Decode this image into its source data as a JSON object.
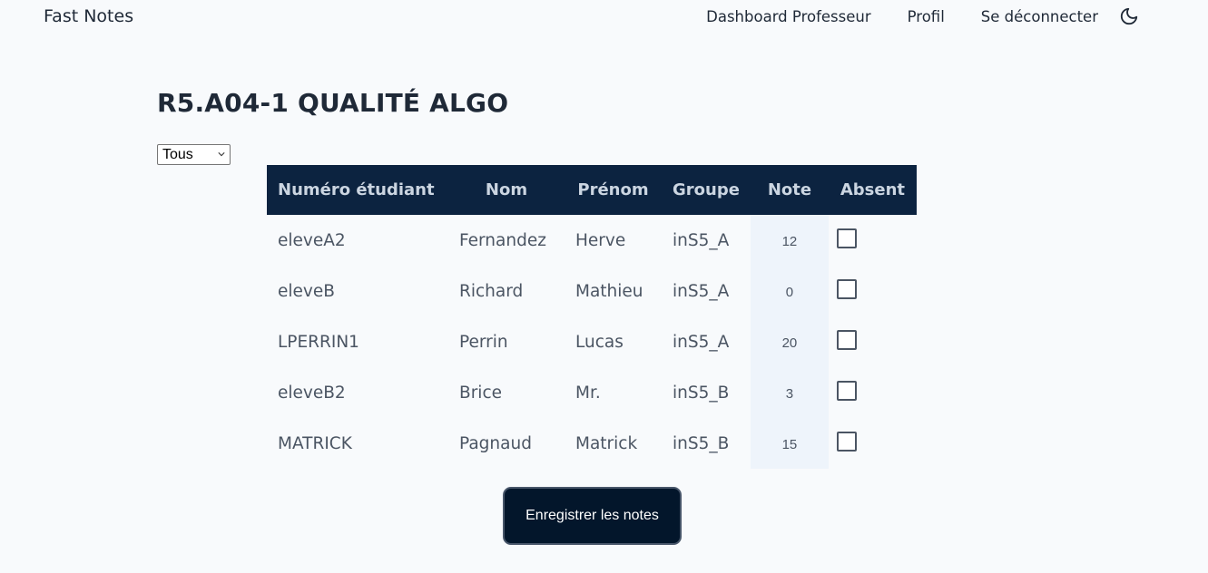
{
  "navbar": {
    "brand": "Fast Notes",
    "links": [
      {
        "label": "Dashboard Professeur"
      },
      {
        "label": "Profil"
      },
      {
        "label": "Se déconnecter"
      }
    ],
    "theme_icon": "moon-icon"
  },
  "page": {
    "title": "R5.A04-1 QUALITÉ ALGO"
  },
  "filter": {
    "selected": "Tous"
  },
  "table": {
    "headers": [
      "Numéro étudiant",
      "Nom",
      "Prénom",
      "Groupe",
      "Note",
      "Absent"
    ],
    "rows": [
      {
        "numero": "eleveA2",
        "nom": "Fernandez",
        "prenom": "Herve",
        "groupe": "inS5_A",
        "note": "12",
        "absent": false
      },
      {
        "numero": "eleveB",
        "nom": "Richard",
        "prenom": "Mathieu",
        "groupe": "inS5_A",
        "note": "0",
        "absent": false
      },
      {
        "numero": "LPERRIN1",
        "nom": "Perrin",
        "prenom": "Lucas",
        "groupe": "inS5_A",
        "note": "20",
        "absent": false
      },
      {
        "numero": "eleveB2",
        "nom": "Brice",
        "prenom": "Mr.",
        "groupe": "inS5_B",
        "note": "3",
        "absent": false
      },
      {
        "numero": "MATRICK",
        "nom": "Pagnaud",
        "prenom": "Matrick",
        "groupe": "inS5_B",
        "note": "15",
        "absent": false
      }
    ]
  },
  "actions": {
    "save_label": "Enregistrer les notes"
  },
  "colors": {
    "header_bg": "#0c2340",
    "note_column_bg": "#eef4fb",
    "button_bg": "#03162b",
    "page_bg": "#f8fafc"
  }
}
